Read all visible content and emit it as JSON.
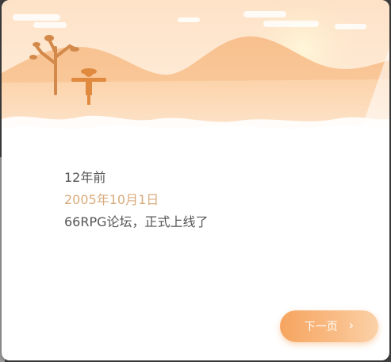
{
  "dialog": {
    "time_ago": "12年前",
    "date": "2005年10月1日",
    "message": "66RPG论坛，正式上线了"
  },
  "buttons": {
    "next_label": "下一页",
    "next_icon": "chevron-right-icon"
  },
  "colors": {
    "accent": "#f6a560",
    "date_text": "#d9ab7c",
    "body_text": "#555555"
  }
}
